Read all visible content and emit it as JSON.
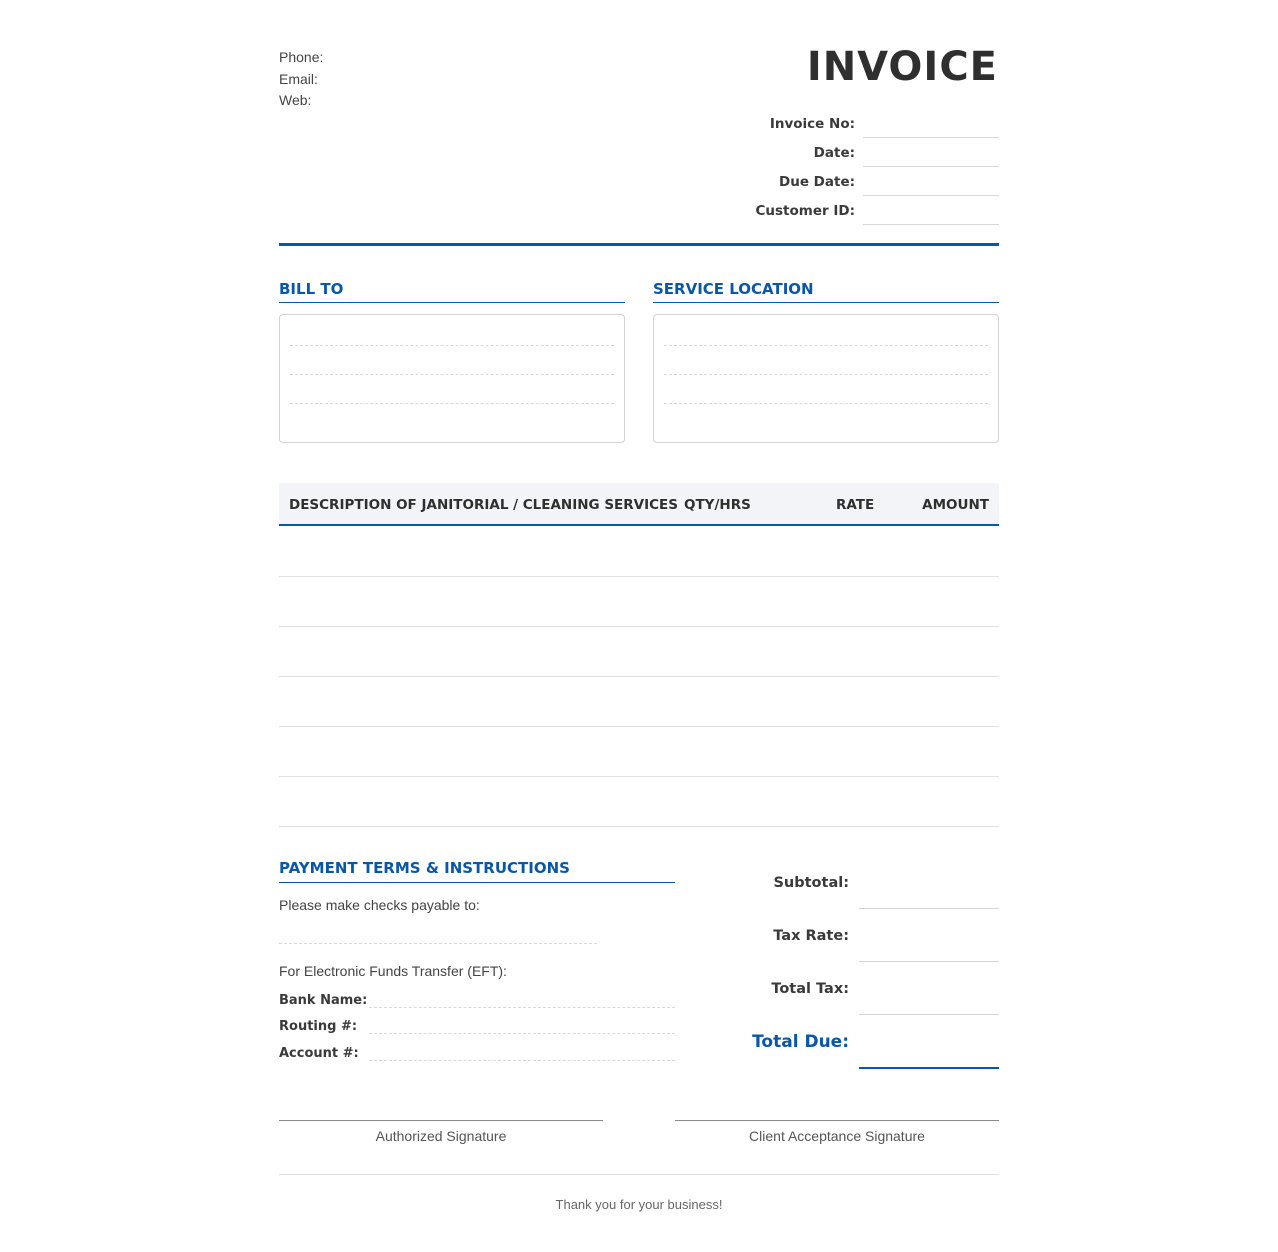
{
  "header": {
    "contact": {
      "phone_label": "Phone:",
      "email_label": "Email:",
      "web_label": "Web:"
    },
    "title": "INVOICE",
    "meta": {
      "invoice_no_label": "Invoice No:",
      "date_label": "Date:",
      "due_date_label": "Due Date:",
      "customer_id_label": "Customer ID:"
    }
  },
  "bill_to": {
    "heading": "BILL TO"
  },
  "service_location": {
    "heading": "SERVICE LOCATION"
  },
  "table": {
    "columns": [
      "DESCRIPTION OF JANITORIAL / CLEANING SERVICES",
      "QTY/HRS",
      "RATE",
      "AMOUNT"
    ],
    "row_count": 6
  },
  "payment": {
    "heading": "PAYMENT TERMS & INSTRUCTIONS",
    "checks_text": "Please make checks payable to:",
    "eft_text": "For Electronic Funds Transfer (EFT):",
    "bank_name_label": "Bank Name:",
    "routing_label": "Routing #:",
    "account_label": "Account #:"
  },
  "totals": {
    "subtotal_label": "Subtotal:",
    "tax_rate_label": "Tax Rate:",
    "total_tax_label": "Total Tax:",
    "total_due_label": "Total Due:"
  },
  "signatures": {
    "authorized": "Authorized Signature",
    "client": "Client Acceptance Signature"
  },
  "footer": {
    "thanks": "Thank you for your business!"
  },
  "colors": {
    "accent": "#0a56a8",
    "text": "#333333",
    "table_header_bg": "#f3f4f8"
  }
}
